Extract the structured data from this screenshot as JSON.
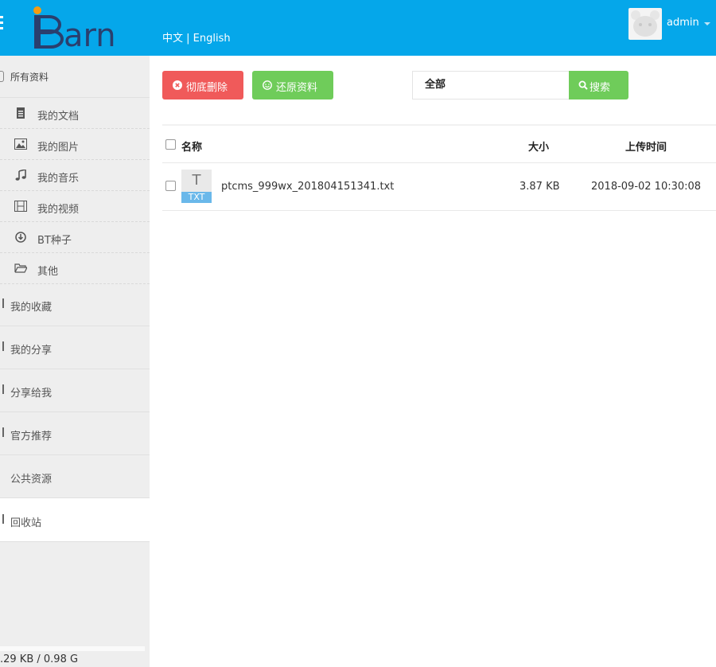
{
  "header": {
    "brand": "iBarn",
    "lang_zh": "中文",
    "lang_sep": " | ",
    "lang_en": "English",
    "username": "admin"
  },
  "sidebar": {
    "all_files": "所有资料",
    "sub_items": [
      {
        "label": "我的文档",
        "icon": "document-icon"
      },
      {
        "label": "我的图片",
        "icon": "image-icon"
      },
      {
        "label": "我的音乐",
        "icon": "music-icon"
      },
      {
        "label": "我的视频",
        "icon": "film-icon"
      },
      {
        "label": "BT种子",
        "icon": "download-circle-icon"
      },
      {
        "label": "其他",
        "icon": "folder-open-icon"
      }
    ],
    "groups": [
      {
        "label": "我的收藏"
      },
      {
        "label": "我的分享"
      },
      {
        "label": "分享给我"
      },
      {
        "label": "官方推荐"
      },
      {
        "label": "公共资源"
      },
      {
        "label": "回收站",
        "active": true
      }
    ],
    "storage": ".29 KB / 0.98 G"
  },
  "toolbar": {
    "delete_label": "彻底删除",
    "restore_label": "还原资料",
    "scope_label": "全部",
    "search_placeholder": "",
    "search_label": "搜索"
  },
  "table": {
    "columns": [
      "名称",
      "大小",
      "上传时间"
    ],
    "rows": [
      {
        "type_letter": "T",
        "type_label": "TXT",
        "name": "ptcms_999wx_201804151341.txt",
        "size": "3.87 KB",
        "time": "2018-09-02 10:30:08"
      }
    ]
  },
  "colors": {
    "header": "#05a7ea",
    "danger": "#f05a5a",
    "success": "#6fcc5a",
    "sidebar": "#eeeeee"
  }
}
